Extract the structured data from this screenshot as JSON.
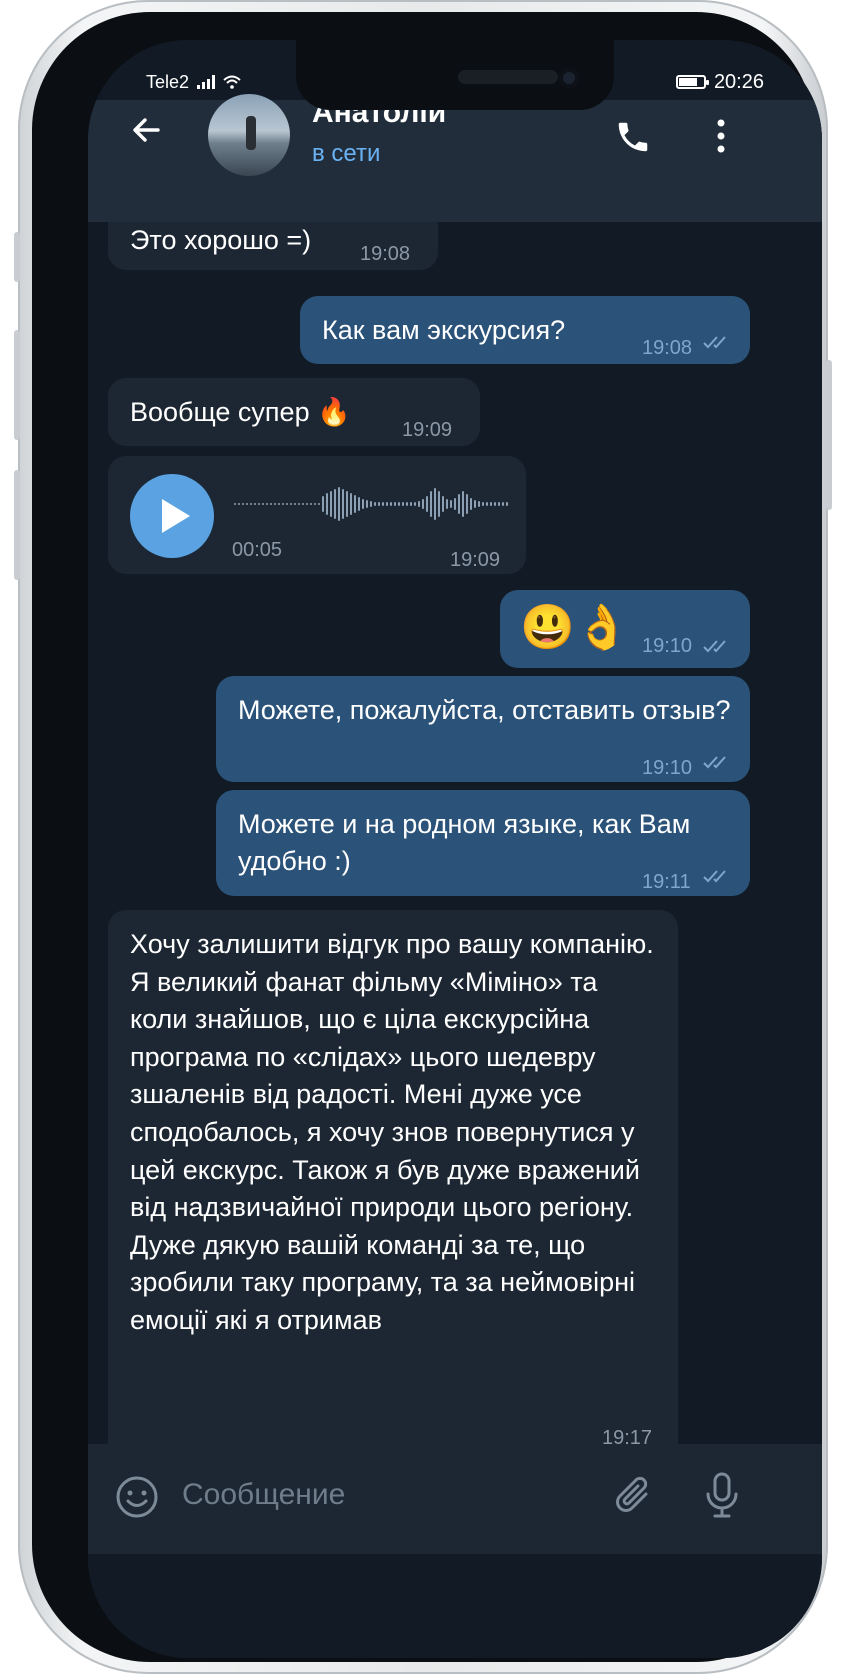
{
  "status_bar": {
    "carrier": "Tele2",
    "time": "20:26",
    "battery_level": 0.75
  },
  "header": {
    "contact_name": "Анатолій",
    "presence": "в сети"
  },
  "messages": [
    {
      "direction": "in",
      "text": "Это хорошо =)",
      "time": "19:08"
    },
    {
      "direction": "out",
      "text": "Как вам экскурсия?",
      "time": "19:08"
    },
    {
      "direction": "in",
      "text": "Вообще супер 🔥",
      "time": "19:09"
    },
    {
      "direction": "in",
      "type": "voice",
      "duration": "00:05",
      "time": "19:09"
    },
    {
      "direction": "out",
      "text": "😃👌",
      "time": "19:10"
    },
    {
      "direction": "out",
      "text": "Можете, пожалуйста, отставить отзыв?",
      "time": "19:10"
    },
    {
      "direction": "out",
      "text": "Можете и на родном языке, как Вам удобно :)",
      "time": "19:11"
    },
    {
      "direction": "in",
      "text": "Хочу залишити відгук про вашу компанію. Я великий фанат фільму «Міміно» та коли знайшов, що є ціла екскурсійна програма по «слідах» цього шедевру зшаленів від радості. Мені дуже усе сподобалось, я хочу знов повернутися у цей екскурс. Також я був дуже вражений від надзвичайної природи цього регіону. Дуже дякую вашій команді за те, що зробили таку програму, та за неймовірні емоції які я отримав",
      "time": "19:17"
    }
  ],
  "composer": {
    "placeholder": "Сообщение"
  },
  "colors": {
    "background": "#121b25",
    "header": "#212d3b",
    "incoming": "#1d2733",
    "outgoing": "#2b5278",
    "accent": "#6ab2f2",
    "play_button": "#5aa2e2"
  },
  "icons": {
    "back": "arrow-left-icon",
    "call": "phone-icon",
    "menu": "more-vertical-icon",
    "emoji": "smile-icon",
    "attach": "paperclip-icon",
    "mic": "microphone-icon",
    "read": "double-check-icon",
    "play": "play-icon"
  }
}
